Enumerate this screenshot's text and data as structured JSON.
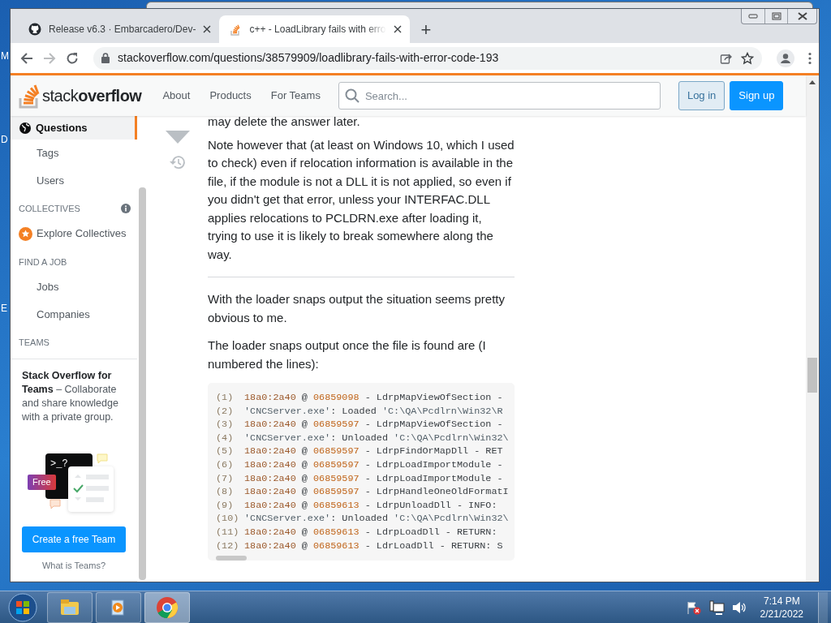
{
  "desktop_labels": [
    "M",
    "D",
    "E"
  ],
  "browser": {
    "tabs": [
      {
        "title": "Release v6.3 · Embarcadero/Dev-",
        "selected": false
      },
      {
        "title": "c++ - LoadLibrary fails with erro",
        "selected": true
      }
    ],
    "new_tab": "+",
    "address": "stackoverflow.com/questions/38579909/loadlibrary-fails-with-error-code-193"
  },
  "site_header": {
    "logo_light": "stack",
    "logo_bold": "overflow",
    "nav": [
      "About",
      "Products",
      "For Teams"
    ],
    "search": {
      "placeholder": "Search..."
    },
    "buttons": [
      {
        "label": "Log in",
        "kind": "secondary"
      },
      {
        "label": "Sign up",
        "kind": "primary"
      }
    ]
  },
  "sidebar": {
    "items": [
      {
        "kind": "link",
        "label": "Questions",
        "selected": true
      },
      {
        "kind": "link",
        "label": "Tags",
        "selected": false
      },
      {
        "kind": "link",
        "label": "Users",
        "selected": false
      },
      {
        "kind": "heading",
        "label": "COLLECTIVES",
        "info": true
      },
      {
        "kind": "link",
        "label": "Explore Collectives",
        "selected": false
      },
      {
        "kind": "heading",
        "label": "FIND A JOB",
        "info": false
      },
      {
        "kind": "link",
        "label": "Jobs",
        "selected": false
      },
      {
        "kind": "link",
        "label": "Companies",
        "selected": false
      },
      {
        "kind": "heading",
        "label": "TEAMS",
        "info": false
      }
    ],
    "teams_card": {
      "text": "**Stack Overflow for Teams** – Collaborate and share knowledge with a private group.",
      "prompt": ">_?",
      "badge": "Free",
      "button": "Create a free Team",
      "link": "What is Teams?"
    }
  },
  "answer": {
    "cut_text": "may delete the answer later.",
    "paragraphs": [
      [
        "Note however that (at least on Windows 10, which I used to check) even if relocation information is available in the file, if the module is not a DLL it is not applied, so even if you didn't get that error, unless your INTERFAC.DLL applies relocations to PCLDRN.exe after loading it, trying to use it is likely to break somewhere along the way."
      ],
      [
        "With the loader snaps output the situation seems pretty obvious to me.",
        "The loader snaps output once the file is found are (I numbered the lines):"
      ]
    ],
    "code_lines": [
      {
        "number": "(1)",
        "segments": [
          {
            "kind": "addr",
            "text": "18a0:2a40"
          },
          {
            "kind": "plain",
            "text": " @ "
          },
          {
            "kind": "hex",
            "text": "06859098"
          },
          {
            "kind": "plain",
            "text": " - LdrpMapViewOfSection -"
          }
        ]
      },
      {
        "number": "(2)",
        "segments": [
          {
            "kind": "str",
            "text": "'CNCServer.exe'"
          },
          {
            "kind": "plain",
            "text": ": Loaded "
          },
          {
            "kind": "str",
            "text": "'C:\\QA\\Pcdlrn\\Win32\\R"
          }
        ]
      },
      {
        "number": "(3)",
        "segments": [
          {
            "kind": "addr",
            "text": "18a0:2a40"
          },
          {
            "kind": "plain",
            "text": " @ "
          },
          {
            "kind": "hex",
            "text": "06859597"
          },
          {
            "kind": "plain",
            "text": " - LdrpMapViewOfSection -"
          }
        ]
      },
      {
        "number": "(4)",
        "segments": [
          {
            "kind": "str",
            "text": "'CNCServer.exe'"
          },
          {
            "kind": "plain",
            "text": ": Unloaded "
          },
          {
            "kind": "str",
            "text": "'C:\\QA\\Pcdlrn\\Win32\\"
          }
        ]
      },
      {
        "number": "(5)",
        "segments": [
          {
            "kind": "addr",
            "text": "18a0:2a40"
          },
          {
            "kind": "plain",
            "text": " @ "
          },
          {
            "kind": "hex",
            "text": "06859597"
          },
          {
            "kind": "plain",
            "text": " - LdrpFindOrMapDll - RET"
          }
        ]
      },
      {
        "number": "(6)",
        "segments": [
          {
            "kind": "addr",
            "text": "18a0:2a40"
          },
          {
            "kind": "plain",
            "text": " @ "
          },
          {
            "kind": "hex",
            "text": "06859597"
          },
          {
            "kind": "plain",
            "text": " - LdrpLoadImportModule -"
          }
        ]
      },
      {
        "number": "(7)",
        "segments": [
          {
            "kind": "addr",
            "text": "18a0:2a40"
          },
          {
            "kind": "plain",
            "text": " @ "
          },
          {
            "kind": "hex",
            "text": "06859597"
          },
          {
            "kind": "plain",
            "text": " - LdrpLoadImportModule -"
          }
        ]
      },
      {
        "number": "(8)",
        "segments": [
          {
            "kind": "addr",
            "text": "18a0:2a40"
          },
          {
            "kind": "plain",
            "text": " @ "
          },
          {
            "kind": "hex",
            "text": "06859597"
          },
          {
            "kind": "plain",
            "text": " - LdrpHandleOneOldFormatI"
          }
        ]
      },
      {
        "number": "(9)",
        "segments": [
          {
            "kind": "addr",
            "text": "18a0:2a40"
          },
          {
            "kind": "plain",
            "text": " @ "
          },
          {
            "kind": "hex",
            "text": "06859613"
          },
          {
            "kind": "plain",
            "text": " - LdrpUnloadDll - INFO:"
          }
        ]
      },
      {
        "number": "(10)",
        "segments": [
          {
            "kind": "str",
            "text": "'CNCServer.exe'"
          },
          {
            "kind": "plain",
            "text": ": Unloaded "
          },
          {
            "kind": "str",
            "text": "'C:\\QA\\Pcdlrn\\Win32\\"
          }
        ]
      },
      {
        "number": "(11)",
        "segments": [
          {
            "kind": "addr",
            "text": "18a0:2a40"
          },
          {
            "kind": "plain",
            "text": " @ "
          },
          {
            "kind": "hex",
            "text": "06859613"
          },
          {
            "kind": "plain",
            "text": " - LdrpLoadDll - RETURN:"
          }
        ]
      },
      {
        "number": "(12)",
        "segments": [
          {
            "kind": "addr",
            "text": "18a0:2a40"
          },
          {
            "kind": "plain",
            "text": " @ "
          },
          {
            "kind": "hex",
            "text": "06859613"
          },
          {
            "kind": "plain",
            "text": " - LdrLoadDll - RETURN: S"
          }
        ]
      }
    ]
  },
  "taskbar": {
    "apps": [
      {
        "kind": "explorer",
        "selected": false
      },
      {
        "kind": "media",
        "selected": false
      },
      {
        "kind": "chrome",
        "selected": true
      }
    ],
    "time": "7:14 PM",
    "date": "2/21/2022"
  }
}
